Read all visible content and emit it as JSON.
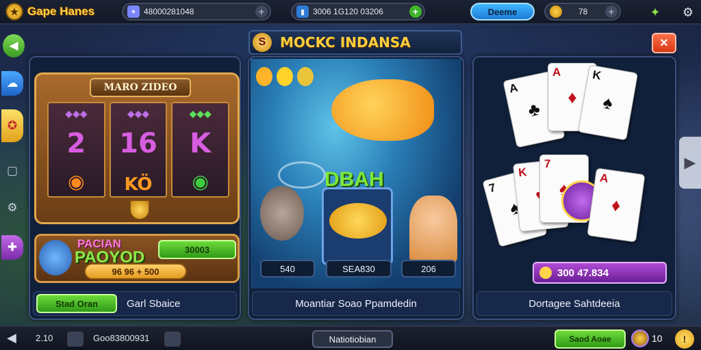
{
  "header": {
    "app_title": "Gaрe Hanes",
    "resource1_value": "48000281048",
    "resource2_value": "3006 1G120 03206",
    "blue_badge_label": "Deeme",
    "coins_value": "78"
  },
  "icons": {
    "logo": "dog-face-icon",
    "resource1": "gem-bag-icon",
    "resource2": "phone-icon",
    "coin": "coin-icon",
    "gift": "gift-icon",
    "settings": "gear-icon",
    "back": "back-arrow-icon"
  },
  "left_sidebar": [
    "back-arrow",
    "cloud-game",
    "compass",
    "window",
    "settings",
    "puzzle"
  ],
  "slot_panel": {
    "sign_text": "MARO ZIDEO",
    "reel_symbols": [
      "2",
      "16",
      "K",
      "KÖ"
    ],
    "banner_top": "PACIAN",
    "banner_bottom": "PAOYOD",
    "green_value": "30003",
    "bet_text": "96 96 + 500",
    "footer_button": "Stad Oran",
    "footer_label": "Garl Sbaice"
  },
  "fishing_panel": {
    "title": "MOCKC INDANSA",
    "sign_text": "DBAH",
    "left_value": "540",
    "mid_value": "SEA830",
    "right_value": "206",
    "footer_label": "Moantiar Soao Ppamdedin"
  },
  "cards_panel": {
    "purple_value": "300 47.834",
    "footer_label": "Dortagee Sahtdeeia"
  },
  "footer": {
    "left_time": "2.10",
    "left_code": "Goo83800931",
    "center_button": "Natiotiobian",
    "right_button": "Saod Aoae",
    "right_count": "10"
  }
}
